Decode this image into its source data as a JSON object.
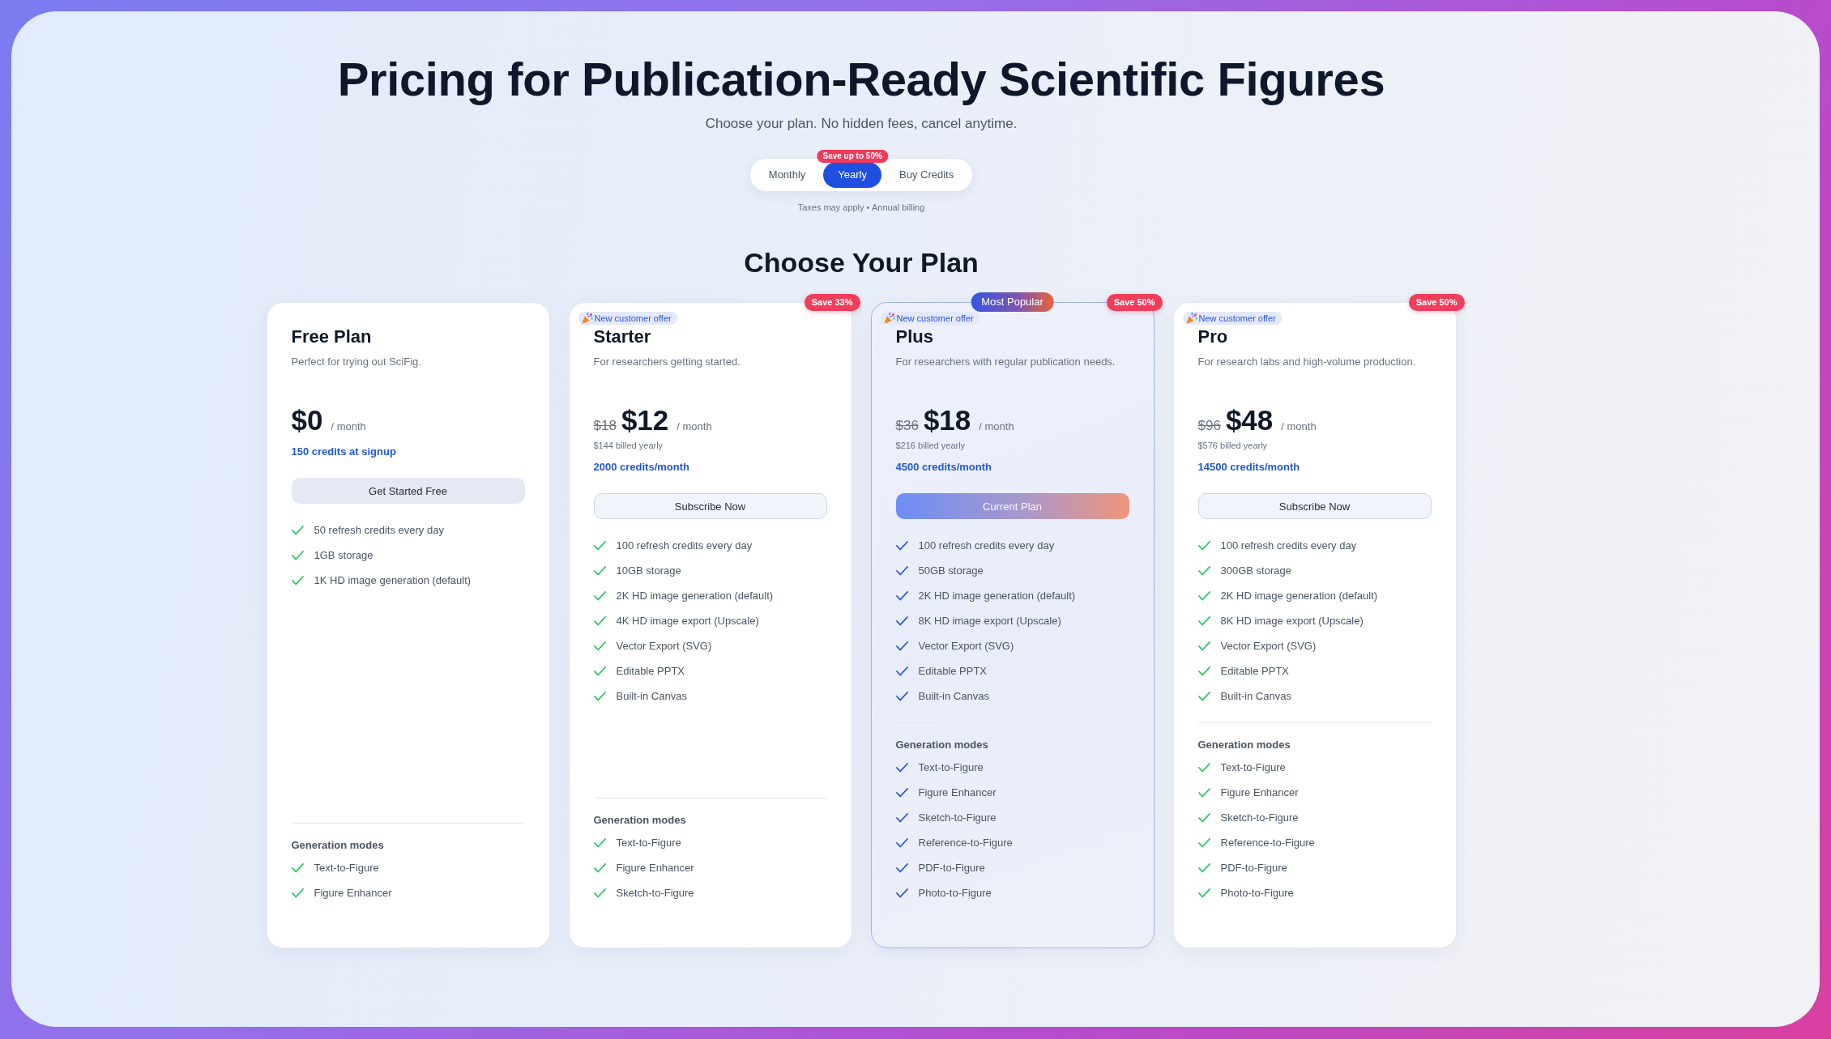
{
  "header": {
    "title": "Pricing for Publication-Ready Scientific Figures",
    "subtitle": "Choose your plan. No hidden fees, cancel anytime."
  },
  "billing_toggle": {
    "options": [
      {
        "label": "Monthly",
        "selected": false
      },
      {
        "label": "Yearly",
        "selected": true,
        "badge": "Save up to 50%"
      },
      {
        "label": "Buy Credits",
        "selected": false
      }
    ],
    "note": "Taxes may apply • Annual billing"
  },
  "section_title": "Choose Your Plan",
  "plans": [
    {
      "name": "Free Plan",
      "description": "Perfect for trying out SciFig.",
      "highlighted": false,
      "price": "$0",
      "period": "/ month",
      "credits": "150 credits at signup",
      "button": {
        "label": "Get Started Free",
        "kind": "filled"
      },
      "features": [
        "50 refresh credits every day",
        "1GB storage",
        "1K HD image generation (default)"
      ],
      "modes_title": "Generation modes",
      "modes": [
        "Text-to-Figure",
        "Figure Enhancer"
      ]
    },
    {
      "name": "Starter",
      "description": "For researchers getting started.",
      "offer_tag": "New customer offer",
      "save_badge": "Save 33%",
      "highlighted": false,
      "original_price": "$18",
      "price": "$12",
      "period": "/ month",
      "billed": "$144 billed yearly",
      "credits": "2000 credits/month",
      "button": {
        "label": "Subscribe Now",
        "kind": "outline"
      },
      "features": [
        "100 refresh credits every day",
        "10GB storage",
        "2K HD image generation (default)",
        "4K HD image export (Upscale)",
        "Vector Export (SVG)",
        "Editable PPTX",
        "Built-in Canvas"
      ],
      "modes_title": "Generation modes",
      "modes": [
        "Text-to-Figure",
        "Figure Enhancer",
        "Sketch-to-Figure"
      ]
    },
    {
      "name": "Plus",
      "description": "For researchers with regular publication needs.",
      "offer_tag": "New customer offer",
      "save_badge": "Save 50%",
      "ribbon": "Most Popular",
      "highlighted": true,
      "original_price": "$36",
      "price": "$18",
      "period": "/ month",
      "billed": "$216 billed yearly",
      "credits": "4500 credits/month",
      "button": {
        "label": "Current Plan",
        "kind": "current"
      },
      "features": [
        "100 refresh credits every day",
        "50GB storage",
        "2K HD image generation (default)",
        "8K HD image export (Upscale)",
        "Vector Export (SVG)",
        "Editable PPTX",
        "Built-in Canvas"
      ],
      "modes_title": "Generation modes",
      "modes": [
        "Text-to-Figure",
        "Figure Enhancer",
        "Sketch-to-Figure",
        "Reference-to-Figure",
        "PDF-to-Figure",
        "Photo-to-Figure"
      ]
    },
    {
      "name": "Pro",
      "description": "For research labs and high-volume production.",
      "offer_tag": "New customer offer",
      "save_badge": "Save 50%",
      "highlighted": false,
      "original_price": "$96",
      "price": "$48",
      "period": "/ month",
      "billed": "$576 billed yearly",
      "credits": "14500 credits/month",
      "button": {
        "label": "Subscribe Now",
        "kind": "outline"
      },
      "features": [
        "100 refresh credits every day",
        "300GB storage",
        "2K HD image generation (default)",
        "8K HD image export (Upscale)",
        "Vector Export (SVG)",
        "Editable PPTX",
        "Built-in Canvas"
      ],
      "modes_title": "Generation modes",
      "modes": [
        "Text-to-Figure",
        "Figure Enhancer",
        "Sketch-to-Figure",
        "Reference-to-Figure",
        "PDF-to-Figure",
        "Photo-to-Figure"
      ]
    }
  ]
}
